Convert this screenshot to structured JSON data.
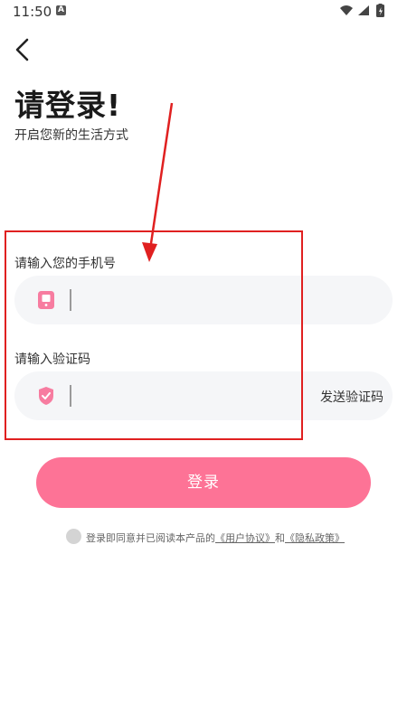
{
  "status_bar": {
    "time": "11:50",
    "notification_letter": "A"
  },
  "header": {
    "title": "请登录!",
    "subtitle": "开启您新的生活方式"
  },
  "phone_field": {
    "label": "请输入您的手机号",
    "value": "",
    "placeholder": ""
  },
  "code_field": {
    "label": "请输入验证码",
    "value": "",
    "placeholder": "",
    "send_code_label": "发送验证码"
  },
  "login_button": {
    "label": "登录"
  },
  "agreement": {
    "prefix": "登录即同意并已阅读本产品的",
    "user_agreement": "《用户协议》",
    "and": "和",
    "privacy_policy": "《隐私政策》",
    "checked": false
  },
  "colors": {
    "accent": "#fd7396",
    "annotation_red": "#e02020",
    "field_bg": "#f5f6f8"
  }
}
